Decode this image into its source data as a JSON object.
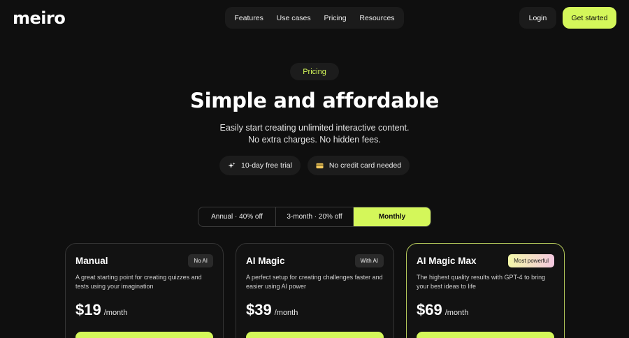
{
  "brand": {
    "logo": "meiro"
  },
  "nav": {
    "items": [
      "Features",
      "Use cases",
      "Pricing",
      "Resources"
    ]
  },
  "header": {
    "login_label": "Login",
    "cta_label": "Get started"
  },
  "hero": {
    "pill": "Pricing",
    "title": "Simple and affordable",
    "subtitle_line1": "Easily start creating unlimited interactive content.",
    "subtitle_line2": "No extra charges. No hidden fees.",
    "features": [
      {
        "icon": "sparkle-icon",
        "label": "10-day free trial"
      },
      {
        "icon": "credit-card-icon",
        "label": "No credit card needed"
      }
    ]
  },
  "billing": {
    "options": [
      "Annual · 40% off",
      "3-month · 20% off",
      "Monthly"
    ],
    "selected": "Monthly"
  },
  "plans": [
    {
      "name": "Manual",
      "badge": "No AI",
      "description": "A great starting point for creating quizzes and tests using your imagination",
      "price": "$19",
      "period": "/month"
    },
    {
      "name": "AI Magic",
      "badge": "With AI",
      "description": "A perfect setup for creating challenges faster and easier using AI power",
      "price": "$39",
      "period": "/month"
    },
    {
      "name": "AI Magic Max",
      "badge": "Most powerful",
      "description": "The highest quality results with GPT-4 to bring your best ideas to life",
      "price": "$69",
      "period": "/month"
    }
  ],
  "colors": {
    "accent": "#d4f75a",
    "background": "#0f0f0f",
    "surface": "#1b1b1b"
  }
}
